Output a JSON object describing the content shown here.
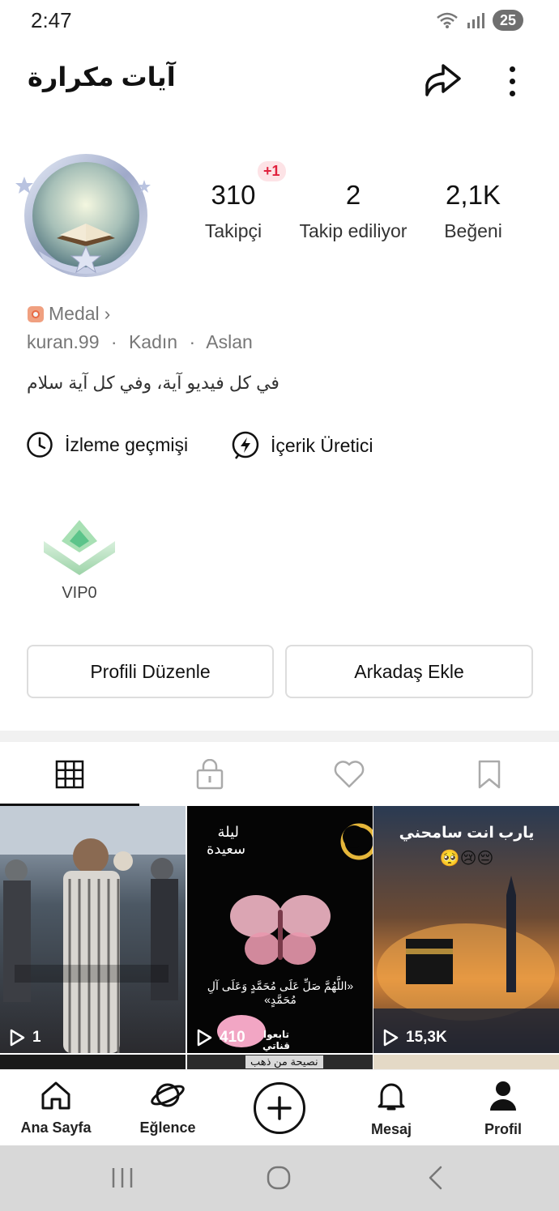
{
  "status": {
    "time": "2:47",
    "battery": "25"
  },
  "header": {
    "title": "آيات مكرارة"
  },
  "stats": [
    {
      "value": "310",
      "label": "Takipçi"
    },
    {
      "value": "2",
      "label": "Takip ediliyor"
    },
    {
      "value": "2,1K",
      "label": "Beğeni"
    }
  ],
  "new_followers_badge": "+1",
  "medal": {
    "label": "Medal",
    "chevron": "›"
  },
  "user": {
    "username": "kuran.99",
    "gender": "Kadın",
    "zodiac": "Aslan",
    "separator": "·"
  },
  "bio": "في كل فيديو آية، وفي كل آية سلام",
  "links": [
    {
      "label": "İzleme geçmişi",
      "icon": "clock-icon"
    },
    {
      "label": "İçerik Üretici",
      "icon": "lightning-icon"
    }
  ],
  "vip": {
    "label": "VIP0"
  },
  "buttons": {
    "edit": "Profili Düzenle",
    "add_friend": "Arkadaş Ekle"
  },
  "tabs": [
    {
      "name": "grid-icon",
      "active": true
    },
    {
      "name": "lock-icon",
      "active": false
    },
    {
      "name": "heart-icon",
      "active": false
    },
    {
      "name": "bookmark-icon",
      "active": false
    }
  ],
  "videos": [
    {
      "views": "1",
      "overlay": ""
    },
    {
      "views": "410",
      "overlay_top": "ليلة سعيدة",
      "overlay_mid": "«اللَّهُمَّ صَلِّ عَلَى مُحَمَّدٍ وَعَلَى آلِ مُحَمَّدٍ»",
      "sticker": "تابعوا قناتي"
    },
    {
      "views": "15,3K",
      "overlay_top": "يارب انت سامحني",
      "emoji": "🥺😢😔"
    }
  ],
  "next_row_caption": "نصيحة من ذهب",
  "nav": [
    {
      "label": "Ana Sayfa",
      "icon": "home-icon"
    },
    {
      "label": "Eğlence",
      "icon": "planet-icon"
    },
    {
      "label": "",
      "icon": "plus-icon"
    },
    {
      "label": "Mesaj",
      "icon": "bell-icon"
    },
    {
      "label": "Profil",
      "icon": "profile-icon"
    }
  ],
  "colors": {
    "accent_red": "#e0203c",
    "text_gray": "#777777",
    "divider": "#f1f1f1"
  }
}
